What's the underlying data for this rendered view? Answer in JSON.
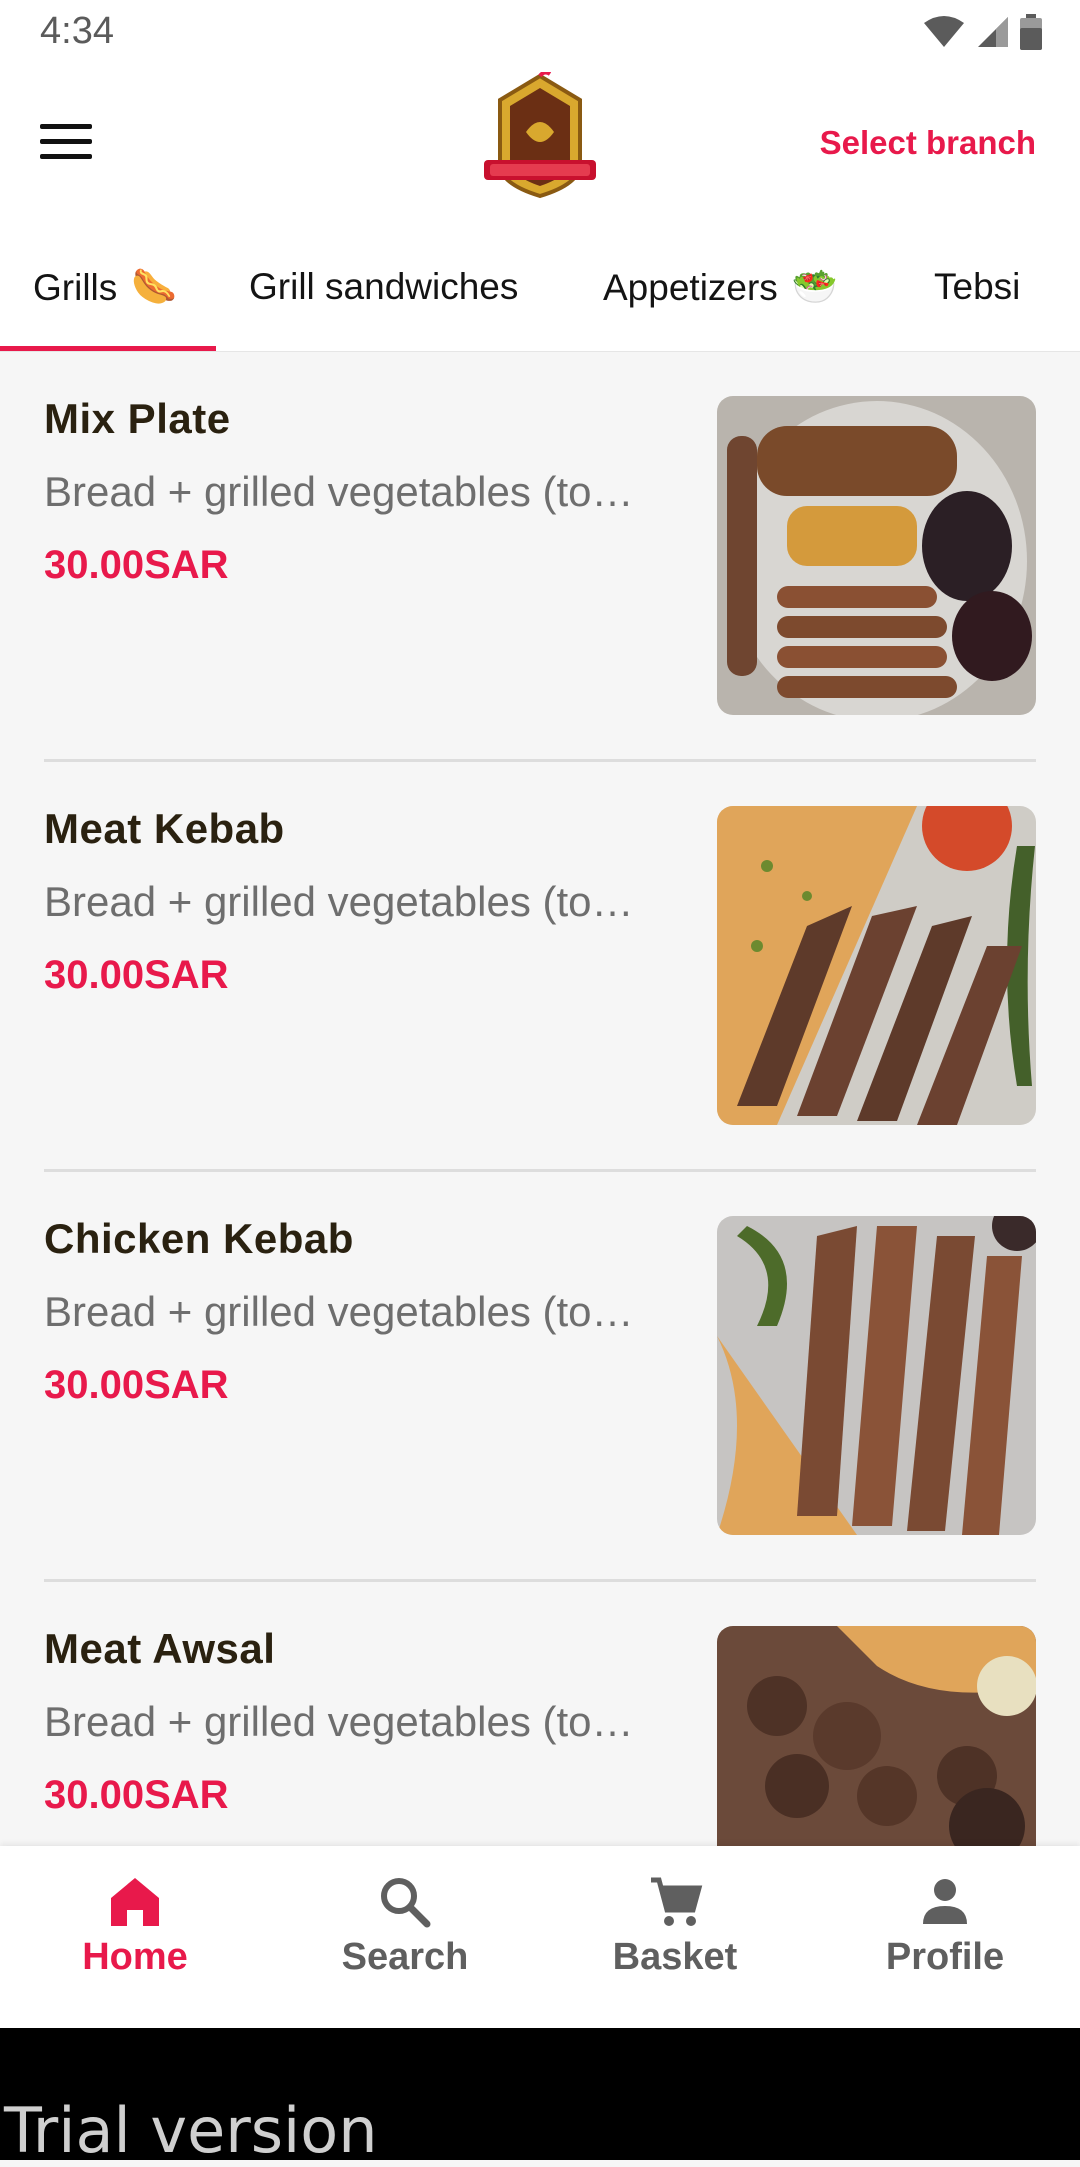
{
  "status_bar": {
    "time": "4:34"
  },
  "header": {
    "select_branch_label": "Select branch"
  },
  "tabs": [
    {
      "label": "Grills",
      "emoji": "🌭"
    },
    {
      "label": "Grill sandwiches",
      "emoji": ""
    },
    {
      "label": "Appetizers",
      "emoji": "🥗"
    },
    {
      "label": "Tebsi",
      "emoji": ""
    }
  ],
  "items": [
    {
      "name": "Mix Plate",
      "description": "Bread + grilled vegetables (to…",
      "price": "30.00SAR"
    },
    {
      "name": "Meat Kebab",
      "description": "Bread + grilled vegetables (to…",
      "price": "30.00SAR"
    },
    {
      "name": "Chicken Kebab",
      "description": "Bread + grilled vegetables (to…",
      "price": "30.00SAR"
    },
    {
      "name": "Meat Awsal",
      "description": "Bread + grilled vegetables (to…",
      "price": "30.00SAR"
    }
  ],
  "bottom_nav": [
    {
      "label": "Home",
      "icon": "home-icon",
      "active": true
    },
    {
      "label": "Search",
      "icon": "search-icon",
      "active": false
    },
    {
      "label": "Basket",
      "icon": "cart-icon",
      "active": false
    },
    {
      "label": "Profile",
      "icon": "person-icon",
      "active": false
    }
  ],
  "watermark": "Trial version",
  "colors": {
    "accent": "#e8194b",
    "text_dark": "#2a2110",
    "text_muted": "#6e6e6e"
  }
}
